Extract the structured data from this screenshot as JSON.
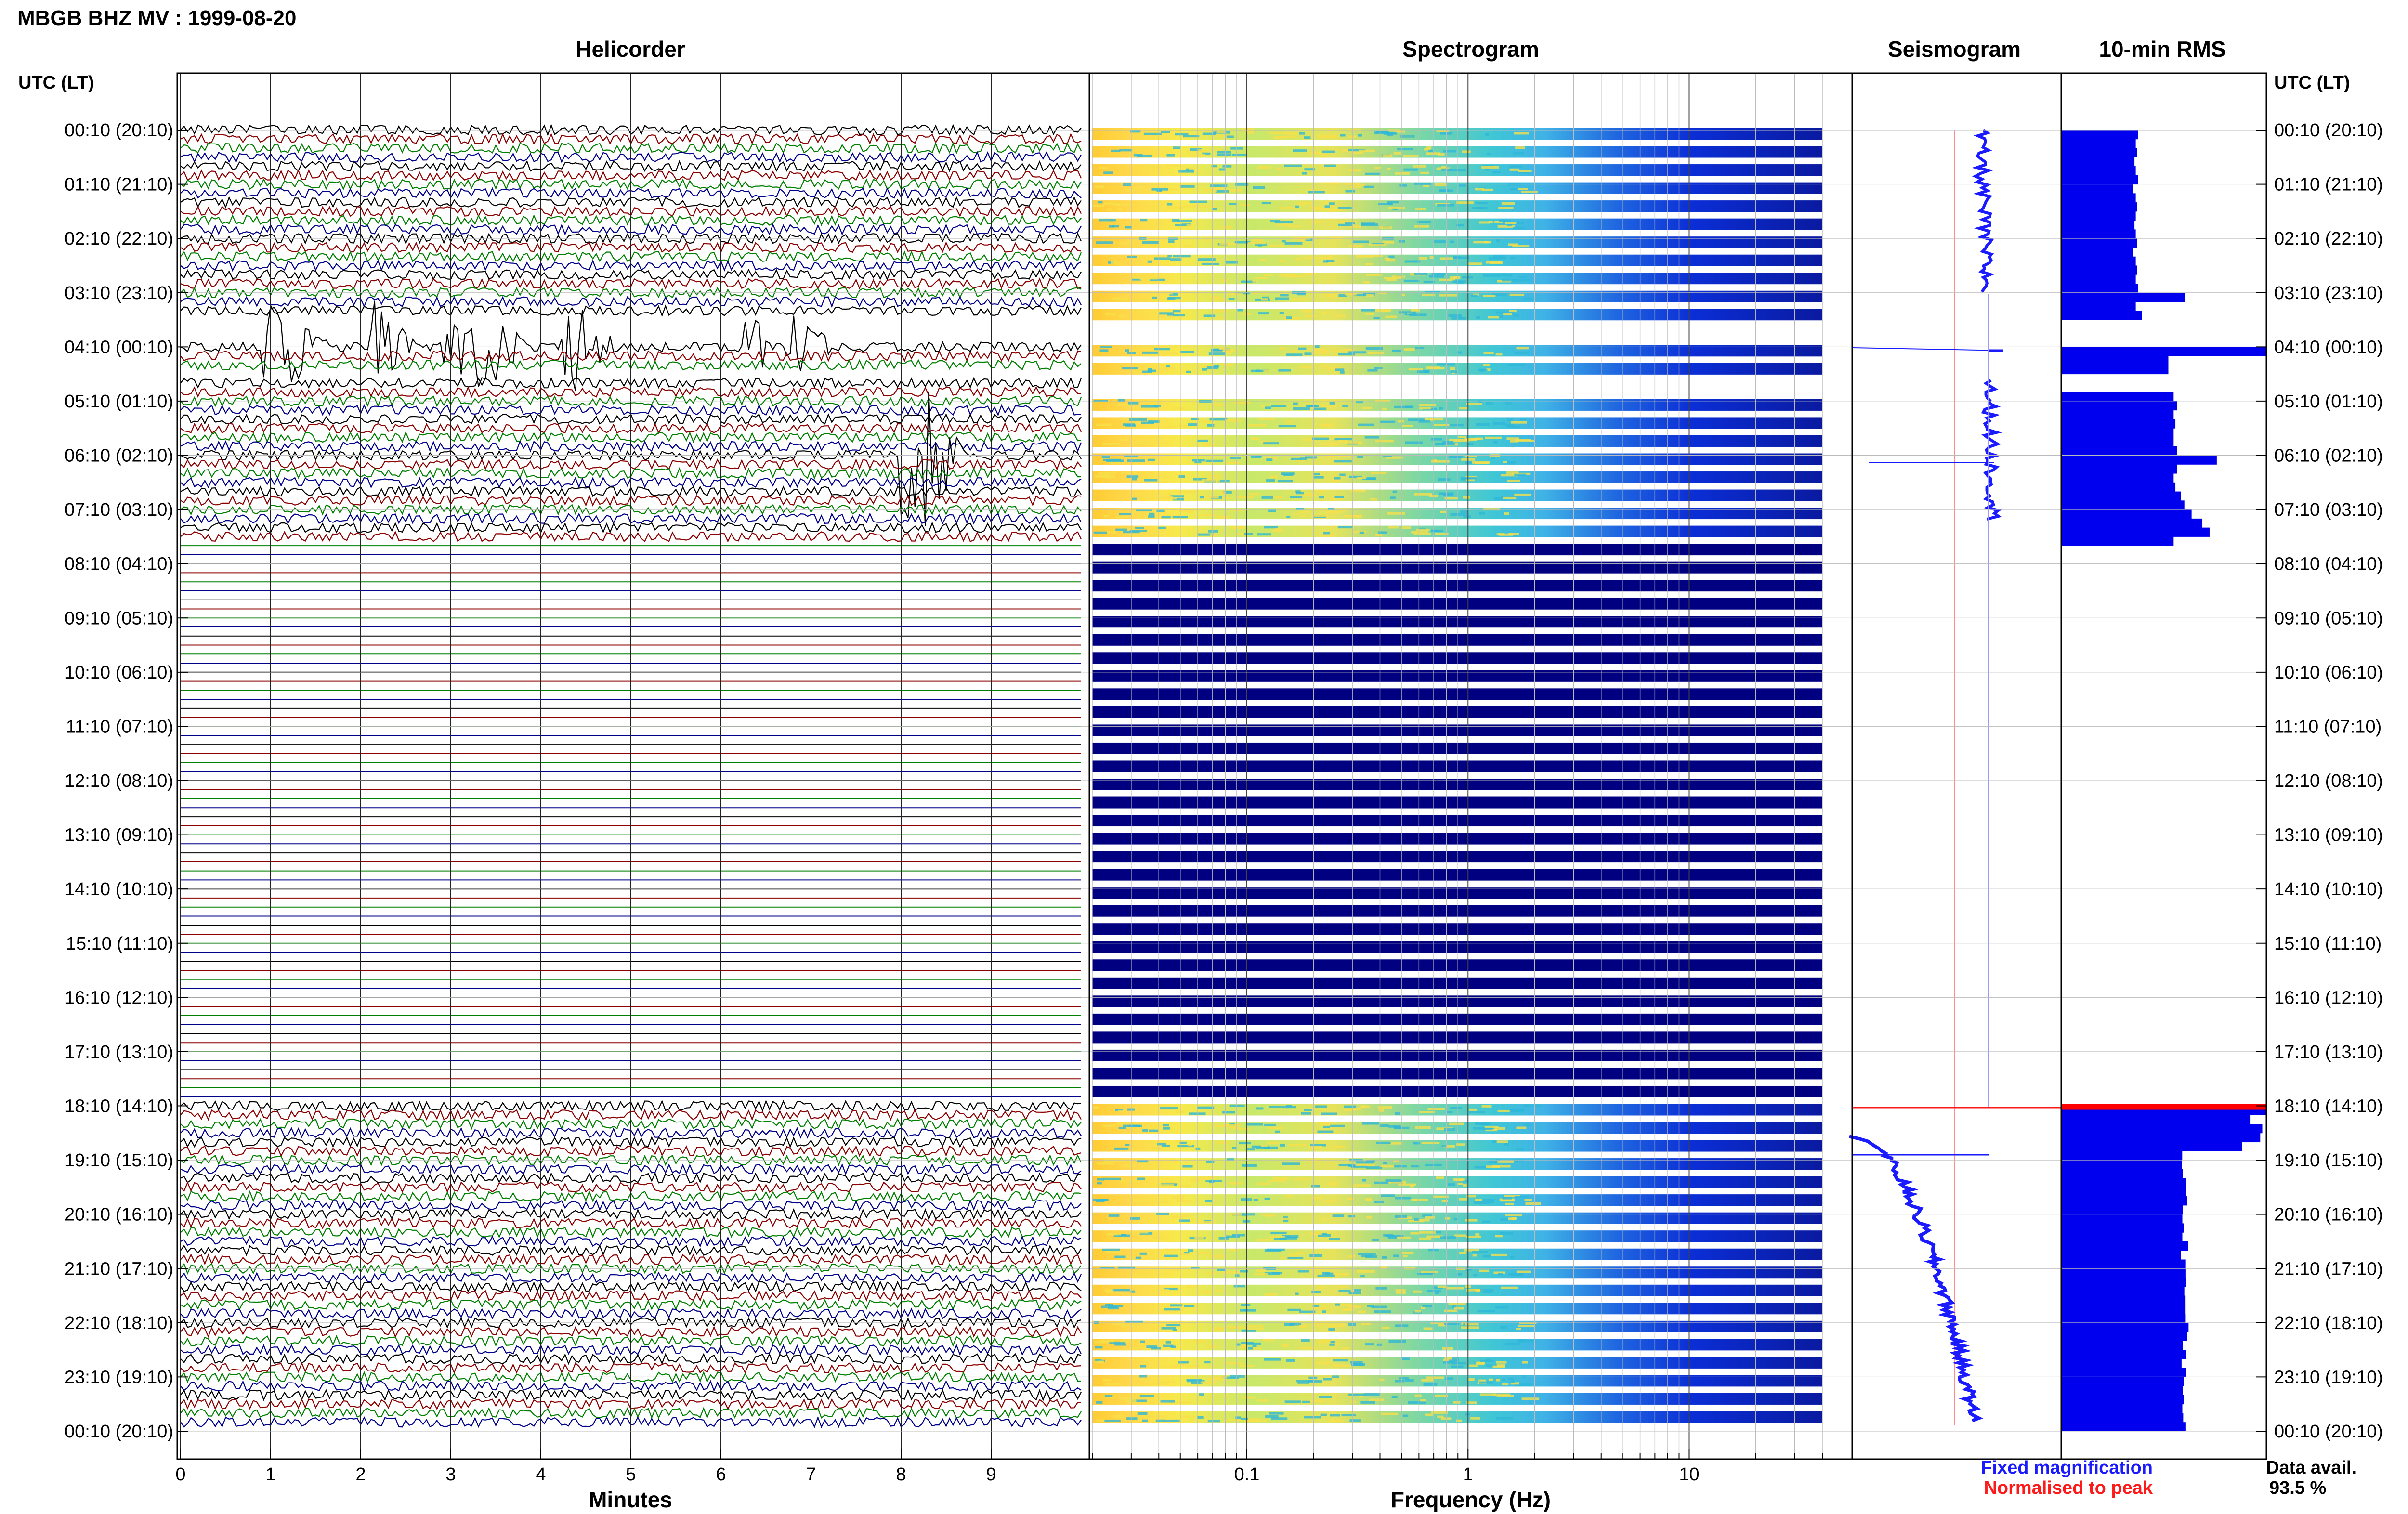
{
  "title": "MBGB BHZ MV : 1999-08-20",
  "panels": {
    "helicorder": "Helicorder",
    "spectrogram": "Spectrogram",
    "seismogram": "Seismogram",
    "rms": "10-min RMS"
  },
  "axis_header_left": "UTC (LT)",
  "axis_header_right": "UTC (LT)",
  "time_labels": [
    "00:10 (20:10)",
    "01:10 (21:10)",
    "02:10 (22:10)",
    "03:10 (23:10)",
    "04:10 (00:10)",
    "05:10 (01:10)",
    "06:10 (02:10)",
    "07:10 (03:10)",
    "08:10 (04:10)",
    "09:10 (05:10)",
    "10:10 (06:10)",
    "11:10 (07:10)",
    "12:10 (08:10)",
    "13:10 (09:10)",
    "14:10 (10:10)",
    "15:10 (11:10)",
    "16:10 (12:10)",
    "17:10 (13:10)",
    "18:10 (14:10)",
    "19:10 (15:10)",
    "20:10 (16:10)",
    "21:10 (17:10)",
    "22:10 (18:10)",
    "23:10 (19:10)",
    "00:10 (20:10)"
  ],
  "helicorder_axis": {
    "label": "Minutes",
    "ticks": [
      "0",
      "1",
      "2",
      "3",
      "4",
      "5",
      "6",
      "7",
      "8",
      "9"
    ]
  },
  "spectrogram_axis": {
    "label": "Frequency (Hz)",
    "ticks": [
      "0.1",
      "1",
      "10"
    ],
    "scale": "log",
    "range": [
      0.02,
      40
    ]
  },
  "legend": {
    "fixed": "Fixed magnification",
    "normalised": "Normalised to peak",
    "fixed_color": "#1a1aff",
    "normalised_color": "#ff1a1a"
  },
  "availability": {
    "label": "Data avail.",
    "value": "93.5 %"
  },
  "colors": {
    "trace_cycle": [
      "#000000",
      "#8b0000",
      "#008000",
      "#00008b"
    ],
    "rms_bar": "#0000ee",
    "rms_peak": "#ff0000",
    "spec_empty": "#000080"
  },
  "chart_data": {
    "type": "heatmap",
    "gaps_utc": [
      [
        3.35,
        4.0
      ],
      [
        4.35,
        4.75
      ],
      [
        7.6,
        18.0
      ]
    ],
    "events_utc_hour_minute": [
      [
        4,
        0.9
      ],
      [
        4,
        1.1
      ],
      [
        4,
        2.1
      ],
      [
        4,
        2.9
      ],
      [
        4,
        3.3
      ],
      [
        4,
        4.2
      ],
      [
        4,
        4.3
      ],
      [
        4,
        6.1
      ],
      [
        4,
        6.7
      ],
      [
        6,
        8.0
      ],
      [
        6,
        8.2
      ]
    ],
    "rms_10min_first_session": [
      0.62,
      0.6,
      0.61,
      0.59,
      0.6,
      0.62,
      0.58,
      0.6,
      0.61,
      0.6,
      0.59,
      0.6,
      0.61,
      0.58,
      0.6,
      0.61,
      0.6,
      0.62,
      1.0,
      0.6,
      0.65,
      0.7,
      0.62,
      0.64,
      0.63,
      0.62,
      0.64,
      0.65,
      1.0,
      0.66,
      0.64,
      0.63,
      0.66,
      0.68,
      0.78
    ]
  }
}
